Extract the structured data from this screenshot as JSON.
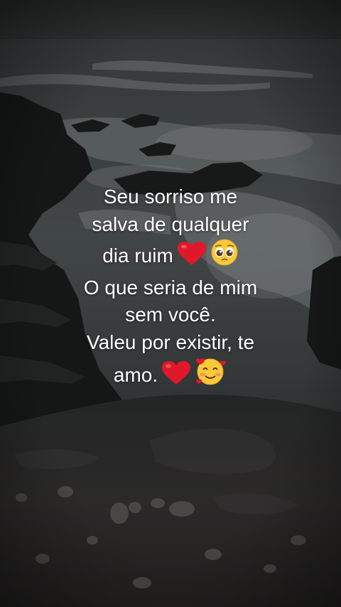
{
  "background": {
    "description_icon": "rocky-sea-shore-night",
    "sky_color": "#3a3d3c",
    "sea_color": "#4a5051",
    "foam_color": "#8e9393",
    "rock_color": "#1d1f1f"
  },
  "caption": {
    "lines": [
      {
        "text": "Seu sorriso me"
      },
      {
        "text": "salva de qualquer"
      },
      {
        "text": "dia ruim",
        "emojis": [
          "red-heart-icon",
          "pleading-face-icon"
        ]
      },
      {
        "text": "O que seria de mim"
      },
      {
        "text": "sem você."
      },
      {
        "text": "Valeu por existir, te"
      },
      {
        "text": "amo.",
        "emojis": [
          "red-heart-icon",
          "smiling-face-with-hearts-icon"
        ]
      }
    ]
  }
}
